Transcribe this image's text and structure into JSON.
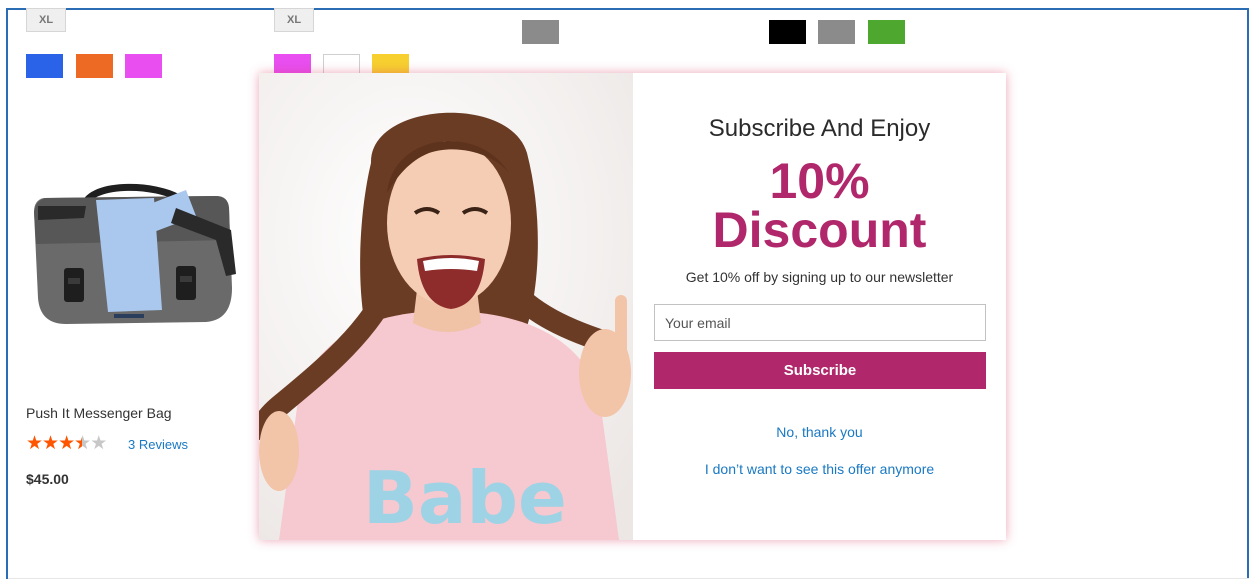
{
  "colors": {
    "accent": "#b0276b",
    "link": "#1979c3",
    "star": "#ff5501",
    "frame": "#2a6db5"
  },
  "size_chips": [
    {
      "label": "XL"
    },
    {
      "label": "XL"
    }
  ],
  "swatches": {
    "col1": [
      "#2b63e8",
      "#ec6a24",
      "#e84ef0"
    ],
    "col2": [
      "#e84ef0",
      "#ffffff",
      "#f7d030"
    ],
    "col3": [
      "#8b8b8b"
    ],
    "col4": [
      "#000000",
      "#8b8b8b",
      "#4ea830"
    ]
  },
  "product": {
    "name": "Push It Messenger Bag",
    "rating": 3.5,
    "rating_max": 5,
    "reviews": "3 Reviews",
    "price": "$45.00",
    "image_icon": "messenger-bag-image"
  },
  "popup": {
    "title": "Subscribe And Enjoy",
    "percent": "10%",
    "discount": "Discount",
    "subtext": "Get 10% off by signing up to our newsletter",
    "email_placeholder": "Your email",
    "email_value": "",
    "subscribe_label": "Subscribe",
    "decline_label": "No, thank you",
    "never_label": "I don’t want to see this offer anymore",
    "photo": "laughing-woman-photo",
    "shirt_text": "Babe"
  }
}
